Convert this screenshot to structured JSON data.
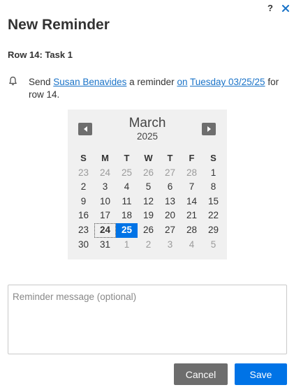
{
  "header": {
    "help_glyph": "?",
    "close_glyph": "×",
    "title": "New Reminder"
  },
  "row_label": "Row 14: Task 1",
  "reminder": {
    "prefix": "Send",
    "recipient": "Susan Benavides",
    "middle": "a reminder",
    "on_link": "on",
    "date_link": "Tuesday 03/25/25",
    "suffix": "for row 14."
  },
  "calendar": {
    "month": "March",
    "year": "2025",
    "weekdays": [
      "S",
      "M",
      "T",
      "W",
      "T",
      "F",
      "S"
    ],
    "weeks": [
      [
        "23",
        "24",
        "25",
        "26",
        "27",
        "28",
        "1"
      ],
      [
        "2",
        "3",
        "4",
        "5",
        "6",
        "7",
        "8"
      ],
      [
        "9",
        "10",
        "11",
        "12",
        "13",
        "14",
        "15"
      ],
      [
        "16",
        "17",
        "18",
        "19",
        "20",
        "21",
        "22"
      ],
      [
        "23",
        "24",
        "25",
        "26",
        "27",
        "28",
        "29"
      ],
      [
        "30",
        "31",
        "1",
        "2",
        "3",
        "4",
        "5"
      ]
    ],
    "today": "24",
    "selected": "25"
  },
  "message": {
    "placeholder": "Reminder message (optional)",
    "value": ""
  },
  "buttons": {
    "cancel": "Cancel",
    "save": "Save"
  },
  "colors": {
    "accent": "#0073e6",
    "link": "#1a73c8",
    "cancel_bg": "#6d6d6d",
    "calendar_bg": "#f0f0f0"
  },
  "icons": {
    "help": "help-icon",
    "close": "close-icon",
    "bell": "bell-icon",
    "prev": "chevron-left-icon",
    "next": "chevron-right-icon"
  }
}
